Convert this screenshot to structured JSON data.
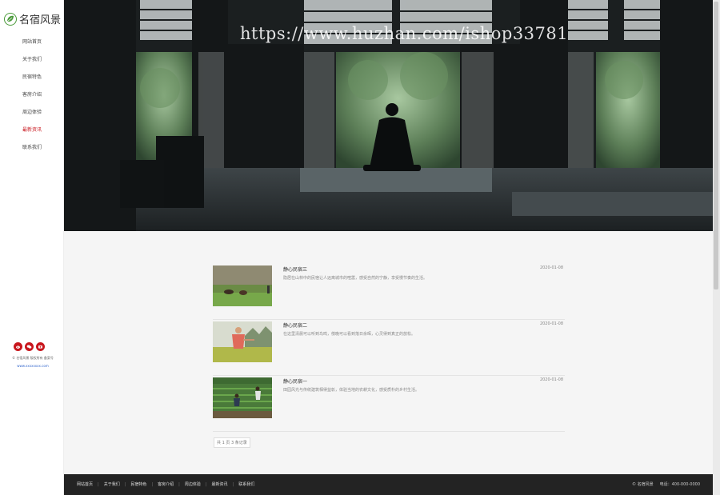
{
  "brand": {
    "name": "名宿风景"
  },
  "nav": [
    {
      "label": "网站首页"
    },
    {
      "label": "关于我们"
    },
    {
      "label": "民宿特色"
    },
    {
      "label": "客房介绍"
    },
    {
      "label": "周边体验"
    },
    {
      "label": "最新资讯"
    },
    {
      "label": "联系我们"
    }
  ],
  "social_icons": [
    "weibo-icon",
    "wechat-icon",
    "camera-icon"
  ],
  "sidebar_footer": {
    "line1": "© 名宿风景 版权所有 备案号",
    "line2": "www.xxxxxxxx.com"
  },
  "banner": {
    "watermark": "https://www.huzhan.com/ishop33781"
  },
  "articles": [
    {
      "title": "静心民宿三",
      "date": "2020-01-08",
      "desc": "隐居在山林中的民宿让人远离城市的喧嚣，感受自然的宁静，享受慢节奏的生活。"
    },
    {
      "title": "静心民宿二",
      "date": "2020-01-08",
      "desc": "在这里清晨可以听到鸟鸣，傍晚可以看到落日余晖，心灵得到真正的放松。"
    },
    {
      "title": "静心民宿一",
      "date": "2020-01-08",
      "desc": "田园风光与传统建筑相得益彰，体验当地的农耕文化，感受质朴的乡村生活。"
    }
  ],
  "pager": {
    "label": "共 1 页 3 条记录"
  },
  "footer": {
    "links": [
      {
        "label": "网站首页"
      },
      {
        "label": "关于我们"
      },
      {
        "label": "民宿特色"
      },
      {
        "label": "客房介绍"
      },
      {
        "label": "周边体验"
      },
      {
        "label": "最新资讯"
      },
      {
        "label": "联系我们"
      }
    ],
    "copyright": "© 名宿风景",
    "phone": "电话：400-000-0000"
  },
  "colors": {
    "accent": "#c8161d",
    "footer_bg": "#232323",
    "page_bg": "#f5f5f5"
  }
}
